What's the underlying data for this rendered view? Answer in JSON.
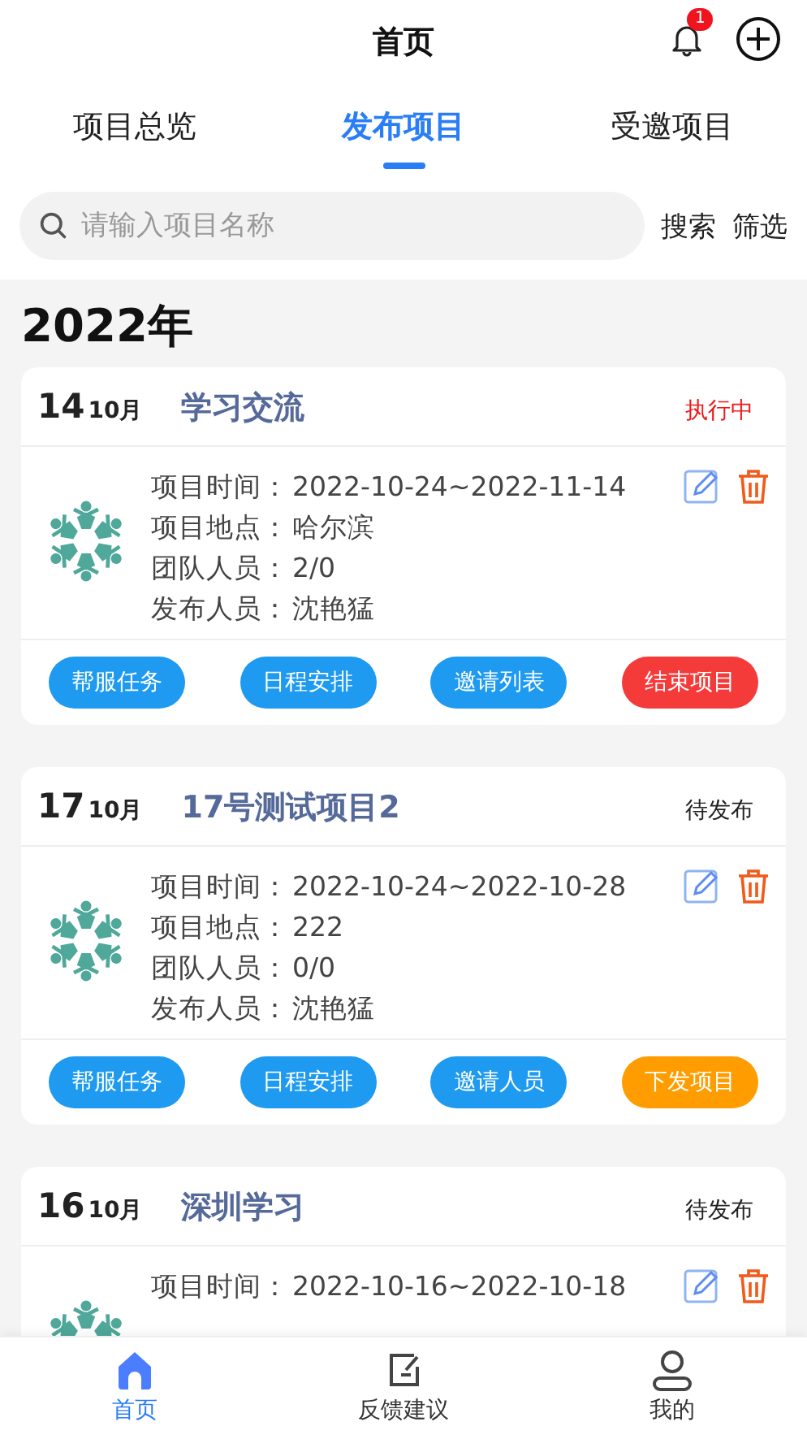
{
  "header": {
    "title": "首页",
    "notification_count": "1"
  },
  "tabs": [
    {
      "label": "项目总览",
      "selected": false
    },
    {
      "label": "发布项目",
      "selected": true
    },
    {
      "label": "受邀项目",
      "selected": false
    }
  ],
  "search": {
    "placeholder": "请输入项目名称",
    "search_button": "搜索",
    "filter_button": "筛选"
  },
  "year": "2022年",
  "projects": [
    {
      "day": "14",
      "month": "10月",
      "name": "学习交流",
      "status": {
        "text": "执行中",
        "kind": "active"
      },
      "fields": [
        {
          "label": "项目时间：",
          "value": "2022-10-24~2022-11-14"
        },
        {
          "label": "项目地点：",
          "value": "哈尔滨"
        },
        {
          "label": "团队人员：",
          "value": "2/0"
        },
        {
          "label": "发布人员：",
          "value": "沈艳猛"
        }
      ],
      "actions": [
        {
          "label": "帮服任务",
          "kind": "normal"
        },
        {
          "label": "日程安排",
          "kind": "normal"
        },
        {
          "label": "邀请列表",
          "kind": "normal"
        },
        {
          "label": "结束项目",
          "kind": "danger"
        }
      ]
    },
    {
      "day": "17",
      "month": "10月",
      "name": "17号测试项目2",
      "status": {
        "text": "待发布",
        "kind": "pending"
      },
      "fields": [
        {
          "label": "项目时间：",
          "value": "2022-10-24~2022-10-28"
        },
        {
          "label": "项目地点：",
          "value": "222"
        },
        {
          "label": "团队人员：",
          "value": "0/0"
        },
        {
          "label": "发布人员：",
          "value": "沈艳猛"
        }
      ],
      "actions": [
        {
          "label": "帮服任务",
          "kind": "normal"
        },
        {
          "label": "日程安排",
          "kind": "normal"
        },
        {
          "label": "邀请人员",
          "kind": "normal"
        },
        {
          "label": "下发项目",
          "kind": "warning"
        }
      ]
    },
    {
      "day": "16",
      "month": "10月",
      "name": "深圳学习",
      "status": {
        "text": "待发布",
        "kind": "pending"
      },
      "fields": [
        {
          "label": "项目时间：",
          "value": "2022-10-16~2022-10-18"
        }
      ]
    }
  ],
  "bottom_nav": [
    {
      "label": "首页",
      "selected": true
    },
    {
      "label": "反馈建议",
      "selected": false
    },
    {
      "label": "我的",
      "selected": false
    }
  ]
}
